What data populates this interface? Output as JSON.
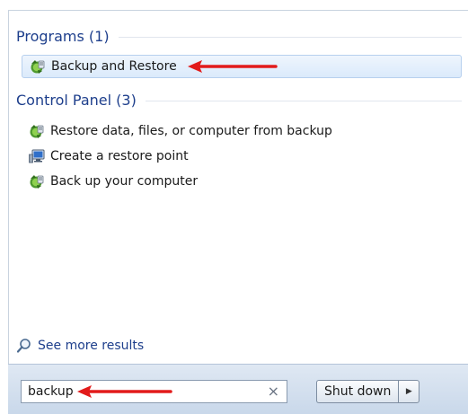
{
  "programs": {
    "title": "Programs (1)",
    "items": [
      {
        "label": "Backup and Restore",
        "icon": "backup-restore-icon"
      }
    ]
  },
  "control_panel": {
    "title": "Control Panel (3)",
    "items": [
      {
        "label": "Restore data, files, or computer from backup",
        "icon": "backup-restore-icon"
      },
      {
        "label": "Create a restore point",
        "icon": "system-monitor-icon"
      },
      {
        "label": "Back up your computer",
        "icon": "backup-restore-icon"
      }
    ]
  },
  "see_more": {
    "label": "See more results",
    "icon": "magnifier-icon"
  },
  "search": {
    "value": "backup",
    "clear_glyph": "×"
  },
  "shutdown": {
    "label": "Shut down",
    "arrow_glyph": "▶"
  },
  "colors": {
    "annotation_arrow": "#e21b1b",
    "group_title": "#1e3f8c",
    "highlight_border": "#b7d0ee"
  }
}
